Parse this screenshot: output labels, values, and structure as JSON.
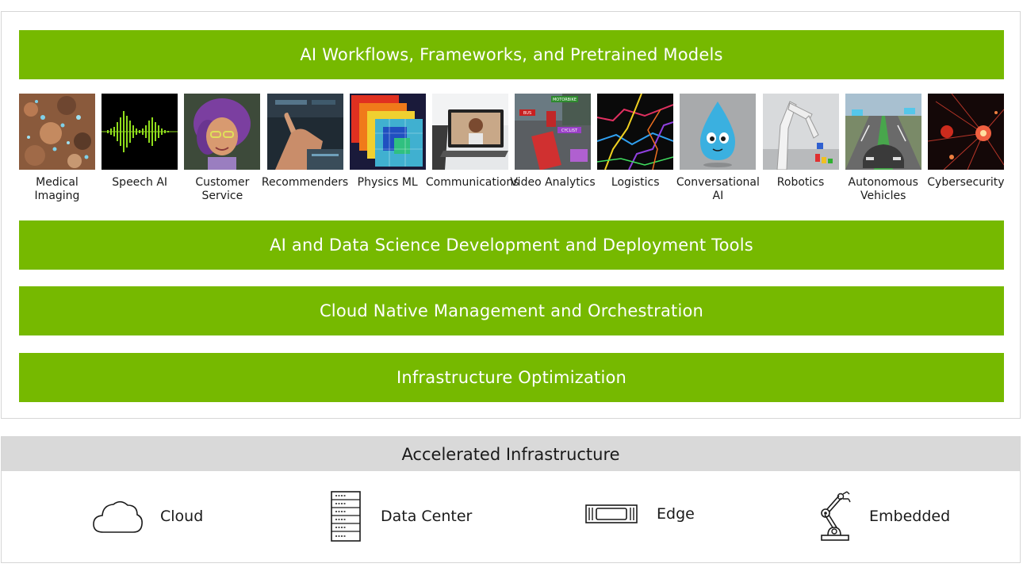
{
  "layers": {
    "workflows": "AI Workflows, Frameworks, and Pretrained Models",
    "dev_tools": "AI and Data Science Development and Deployment Tools",
    "cloud_native": "Cloud Native Management and Orchestration",
    "infra_opt": "Infrastructure Optimization"
  },
  "use_cases": [
    {
      "label": "Medical Imaging"
    },
    {
      "label": "Speech AI"
    },
    {
      "label": "Customer Service"
    },
    {
      "label": "Recommenders"
    },
    {
      "label": "Physics ML"
    },
    {
      "label": "Communications"
    },
    {
      "label": "Video Analytics",
      "tags": [
        "MOTORBIKE",
        "BUS",
        "CYCLIST"
      ]
    },
    {
      "label": "Logistics"
    },
    {
      "label": "Conversational AI"
    },
    {
      "label": "Robotics"
    },
    {
      "label": "Autonomous Vehicles"
    },
    {
      "label": "Cybersecurity"
    }
  ],
  "accelerated": {
    "title": "Accelerated Infrastructure",
    "items": [
      {
        "label": "Cloud",
        "icon": "cloud-icon"
      },
      {
        "label": "Data Center",
        "icon": "server-rack-icon"
      },
      {
        "label": "Edge",
        "icon": "edge-device-icon"
      },
      {
        "label": "Embedded",
        "icon": "robot-arm-icon"
      }
    ]
  },
  "colors": {
    "accent": "#76b900",
    "header_gray": "#d9d9d9",
    "border": "#d6d6d6"
  }
}
